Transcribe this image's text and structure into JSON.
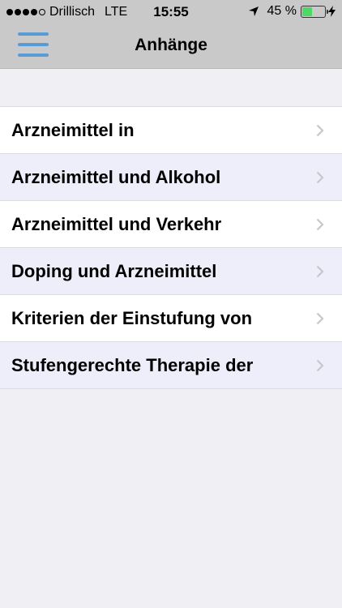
{
  "status_bar": {
    "carrier": "Drillisch",
    "network": "LTE",
    "time": "15:55",
    "battery_percent": "45 %",
    "battery_level": 0.45,
    "signal_bars_filled": 4,
    "signal_bars_total": 5
  },
  "nav": {
    "title": "Anhänge",
    "menu_icon": "hamburger-menu-icon"
  },
  "items": [
    {
      "label": "Arzneimittel in"
    },
    {
      "label": "Arzneimittel und Alkohol"
    },
    {
      "label": "Arzneimittel und Verkehr"
    },
    {
      "label": "Doping und Arzneimittel"
    },
    {
      "label": "Kriterien der Einstufung von"
    },
    {
      "label": "Stufengerechte Therapie der"
    }
  ],
  "colors": {
    "nav_bg": "#c9c9c9",
    "accent": "#5b9bd5",
    "row_alt_bg": "#eeeefb",
    "page_bg": "#efeff4",
    "battery_fill": "#4cd964"
  }
}
